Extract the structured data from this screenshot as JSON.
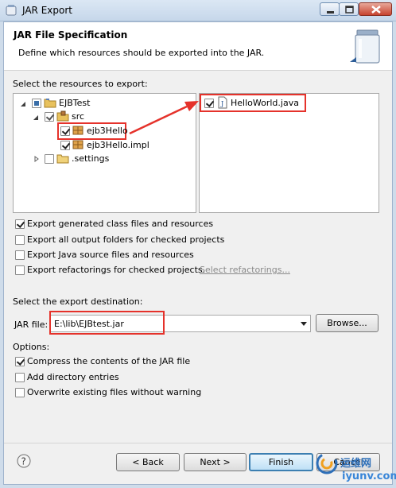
{
  "window": {
    "title": "JAR Export"
  },
  "header": {
    "title": "JAR File Specification",
    "description": "Define which resources should be exported into the JAR."
  },
  "resources": {
    "label": "Select the resources to export:",
    "tree": [
      {
        "label": "EJBTest",
        "state": "partial-filled",
        "expanded": true
      },
      {
        "label": "src",
        "state": "checked",
        "expanded": true
      },
      {
        "label": "ejb3Hello",
        "state": "checked",
        "highlighted": true
      },
      {
        "label": "ejb3Hello.impl",
        "state": "checked"
      },
      {
        "label": ".settings",
        "state": "unchecked",
        "expanded": false
      }
    ],
    "files": [
      {
        "label": "HelloWorld.java",
        "state": "checked",
        "highlighted": true
      }
    ]
  },
  "export_options": [
    {
      "label": "Export generated class files and resources",
      "checked": true
    },
    {
      "label": "Export all output folders for checked projects",
      "checked": false
    },
    {
      "label": "Export Java source files and resources",
      "checked": false
    },
    {
      "label": "Export refactorings for checked projects.",
      "checked": false,
      "link": "Select refactorings..."
    }
  ],
  "destination": {
    "label": "Select the export destination:",
    "jar_file_label": "JAR file:",
    "jar_file_value": "E:\\lib\\EJBtest.jar",
    "browse_label": "Browse..."
  },
  "options": {
    "label": "Options:",
    "items": [
      {
        "label": "Compress the contents of the JAR file",
        "checked": true
      },
      {
        "label": "Add directory entries",
        "checked": false
      },
      {
        "label": "Overwrite existing files without warning",
        "checked": false
      }
    ]
  },
  "buttons": {
    "back": "< Back",
    "next": "Next >",
    "finish": "Finish",
    "cancel": "Cancel"
  },
  "watermark": {
    "text_cn": "运维网",
    "text_en": "iyunv.com"
  },
  "colors": {
    "highlight": "#e5322b",
    "finish_border": "#3c7fb1"
  },
  "icons": [
    "jar-icon",
    "package-icon",
    "java-file-icon",
    "folder-icon",
    "project-icon",
    "help-icon"
  ]
}
